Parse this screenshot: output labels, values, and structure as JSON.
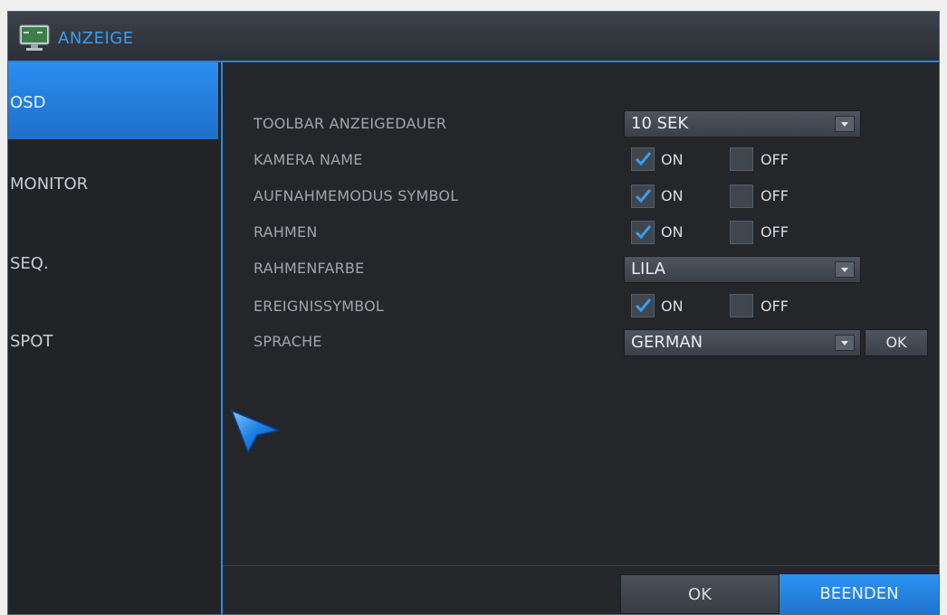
{
  "window": {
    "title": "ANZEIGE",
    "title_icon": "monitor-icon"
  },
  "sidebar": {
    "items": [
      {
        "label": "OSD",
        "active": true
      },
      {
        "label": "MONITOR",
        "active": false
      },
      {
        "label": "SEQ.",
        "active": false
      },
      {
        "label": "SPOT",
        "active": false
      }
    ]
  },
  "settings": {
    "toolbar_duration": {
      "label": "TOOLBAR ANZEIGEDAUER",
      "value": "10 SEK"
    },
    "camera_name": {
      "label": "KAMERA NAME",
      "on_label": "ON",
      "off_label": "OFF",
      "on_checked": true,
      "off_checked": false
    },
    "record_mode_symbol": {
      "label": "AUFNAHMEMODUS SYMBOL",
      "on_label": "ON",
      "off_label": "OFF",
      "on_checked": true,
      "off_checked": false
    },
    "frame": {
      "label": "RAHMEN",
      "on_label": "ON",
      "off_label": "OFF",
      "on_checked": true,
      "off_checked": false
    },
    "frame_color": {
      "label": "RAHMENFARBE",
      "value": "LILA"
    },
    "event_symbol": {
      "label": "EREIGNISSYMBOL",
      "on_label": "ON",
      "off_label": "OFF",
      "on_checked": true,
      "off_checked": false
    },
    "language": {
      "label": "SPRACHE",
      "value": "GERMAN",
      "ok_label": "OK"
    }
  },
  "footer": {
    "ok_label": "OK",
    "exit_label": "BEENDEN"
  },
  "colors": {
    "accent": "#2e8ae6",
    "title_text": "#3a9cf0",
    "background": "#242629"
  }
}
